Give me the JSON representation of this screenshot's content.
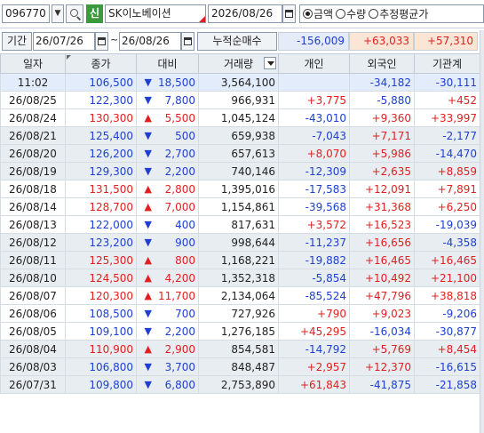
{
  "toolbar": {
    "code": "096770",
    "new_badge": "신",
    "stock_name": "SK이노베이션",
    "date": "2026/08/26",
    "radio_options": [
      {
        "label": "금액",
        "selected": true
      },
      {
        "label": "수량",
        "selected": false
      },
      {
        "label": "추정평균가",
        "selected": false
      }
    ]
  },
  "period": {
    "label": "기간",
    "from": "26/07/26",
    "tilde": "~",
    "to": "26/08/26",
    "cumulative_label": "누적순매수",
    "cum_individual": "-156,009",
    "cum_foreign": "+63,033",
    "cum_institution": "+57,310"
  },
  "columns": [
    "일자",
    "종가",
    "대비",
    "거래량",
    "개인",
    "외국인",
    "기관계"
  ],
  "rows": [
    {
      "date": "11:02",
      "close": "106,500",
      "dir": "down",
      "change": "18,500",
      "volume": "3,564,100",
      "indiv": "",
      "foreign": "-34,182",
      "inst": "-30,111",
      "style": "now"
    },
    {
      "date": "26/08/25",
      "close": "122,300",
      "dir": "down",
      "change": "7,800",
      "volume": "966,931",
      "indiv": "+3,775",
      "foreign": "-5,880",
      "inst": "+452",
      "style": ""
    },
    {
      "date": "26/08/24",
      "close": "130,300",
      "dir": "up",
      "change": "5,500",
      "volume": "1,045,124",
      "indiv": "-43,010",
      "foreign": "+9,360",
      "inst": "+33,997",
      "style": ""
    },
    {
      "date": "26/08/21",
      "close": "125,400",
      "dir": "down",
      "change": "500",
      "volume": "659,938",
      "indiv": "-7,043",
      "foreign": "+7,171",
      "inst": "-2,177",
      "style": "shade"
    },
    {
      "date": "26/08/20",
      "close": "126,200",
      "dir": "down",
      "change": "2,700",
      "volume": "657,613",
      "indiv": "+8,070",
      "foreign": "+5,986",
      "inst": "-14,470",
      "style": "shade"
    },
    {
      "date": "26/08/19",
      "close": "129,300",
      "dir": "down",
      "change": "2,200",
      "volume": "740,146",
      "indiv": "-12,309",
      "foreign": "+2,635",
      "inst": "+8,859",
      "style": "shade"
    },
    {
      "date": "26/08/18",
      "close": "131,500",
      "dir": "up",
      "change": "2,800",
      "volume": "1,395,016",
      "indiv": "-17,583",
      "foreign": "+12,091",
      "inst": "+7,891",
      "style": ""
    },
    {
      "date": "26/08/14",
      "close": "128,700",
      "dir": "up",
      "change": "7,000",
      "volume": "1,154,861",
      "indiv": "-39,568",
      "foreign": "+31,368",
      "inst": "+6,250",
      "style": ""
    },
    {
      "date": "26/08/13",
      "close": "122,000",
      "dir": "down",
      "change": "400",
      "volume": "817,631",
      "indiv": "+3,572",
      "foreign": "+16,523",
      "inst": "-19,039",
      "style": ""
    },
    {
      "date": "26/08/12",
      "close": "123,200",
      "dir": "down",
      "change": "900",
      "volume": "998,644",
      "indiv": "-11,237",
      "foreign": "+16,656",
      "inst": "-4,358",
      "style": "shade"
    },
    {
      "date": "26/08/11",
      "close": "125,300",
      "dir": "up",
      "change": "800",
      "volume": "1,168,221",
      "indiv": "-19,882",
      "foreign": "+16,465",
      "inst": "+16,465",
      "style": "shade"
    },
    {
      "date": "26/08/10",
      "close": "124,500",
      "dir": "up",
      "change": "4,200",
      "volume": "1,352,318",
      "indiv": "-5,854",
      "foreign": "+10,492",
      "inst": "+21,100",
      "style": "shade"
    },
    {
      "date": "26/08/07",
      "close": "120,300",
      "dir": "up",
      "change": "11,700",
      "volume": "2,134,064",
      "indiv": "-85,524",
      "foreign": "+47,796",
      "inst": "+38,818",
      "style": ""
    },
    {
      "date": "26/08/06",
      "close": "108,500",
      "dir": "down",
      "change": "700",
      "volume": "727,926",
      "indiv": "+790",
      "foreign": "+9,023",
      "inst": "-9,206",
      "style": ""
    },
    {
      "date": "26/08/05",
      "close": "109,100",
      "dir": "down",
      "change": "2,200",
      "volume": "1,276,185",
      "indiv": "+45,295",
      "foreign": "-16,034",
      "inst": "-30,877",
      "style": ""
    },
    {
      "date": "26/08/04",
      "close": "110,900",
      "dir": "up",
      "change": "2,900",
      "volume": "854,581",
      "indiv": "-14,792",
      "foreign": "+5,769",
      "inst": "+8,454",
      "style": "shade"
    },
    {
      "date": "26/08/03",
      "close": "106,800",
      "dir": "down",
      "change": "3,700",
      "volume": "848,487",
      "indiv": "+2,957",
      "foreign": "+12,370",
      "inst": "-16,615",
      "style": "shade"
    },
    {
      "date": "26/07/31",
      "close": "109,800",
      "dir": "down",
      "change": "6,800",
      "volume": "2,753,890",
      "indiv": "+61,843",
      "foreign": "-41,875",
      "inst": "-21,858",
      "style": "shade"
    }
  ],
  "colors": {
    "up": "#e02020",
    "down": "#1e3fd0"
  }
}
